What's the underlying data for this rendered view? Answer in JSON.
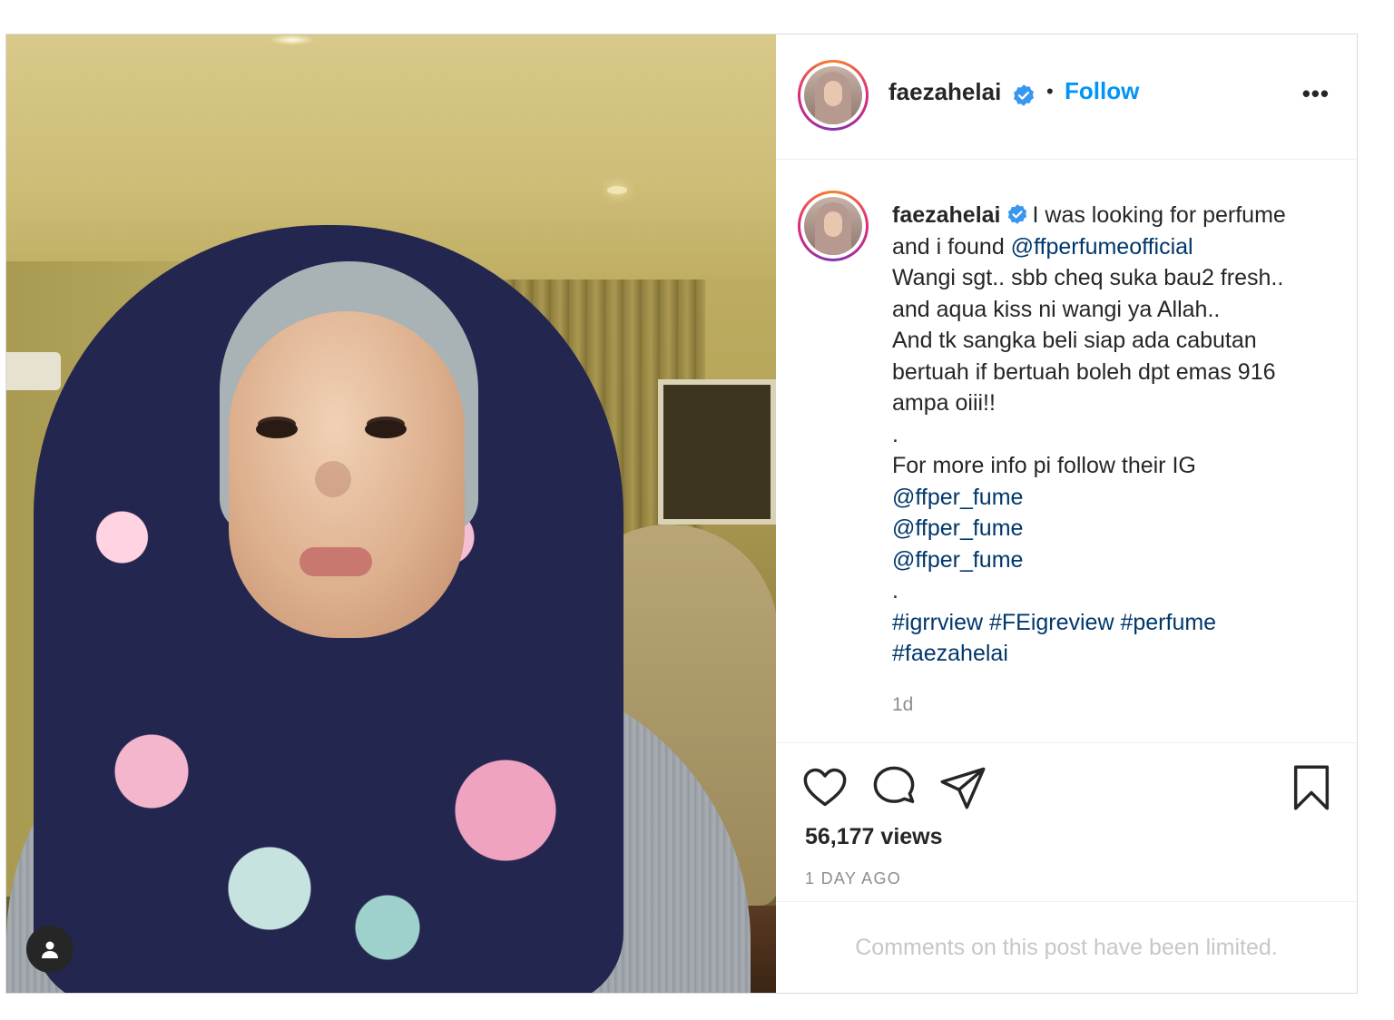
{
  "post": {
    "username": "faezahelai",
    "follow_label": "Follow",
    "separator": "•",
    "more_label": "•••",
    "caption": {
      "username": "faezahelai",
      "line1_rest": "I was looking for perfume",
      "line2_prefix": "and i found ",
      "mention_main": "@ffperfumeofficial",
      "line3": "Wangi sgt.. sbb cheq suka bau2 fresh..",
      "line4": "and aqua kiss ni wangi ya Allah..",
      "line5": "And tk sangka beli siap ada cabutan",
      "line6": "bertuah if bertuah boleh dpt emas 916",
      "line7": "ampa oiii!!",
      "dot1": ".",
      "line8": "For more info pi follow their IG",
      "mention1": "@ffper_fume",
      "mention2": "@ffper_fume",
      "mention3": "@ffper_fume",
      "dot2": ".",
      "tags_line1": "#igrrview #FEigreview #perfume",
      "tags_line2": "#faezahelai"
    },
    "caption_time": "1d",
    "views": "56,177 views",
    "date": "1 DAY AGO",
    "comments_notice": "Comments on this post have been limited."
  },
  "icons": [
    "heart-icon",
    "comment-icon",
    "share-icon",
    "bookmark-icon",
    "verified-badge-icon",
    "user-tag-icon"
  ],
  "colors": {
    "follow": "#0095f6",
    "mention": "#00376b",
    "verified": "#3897f0",
    "muted": "#8e8e8e"
  }
}
